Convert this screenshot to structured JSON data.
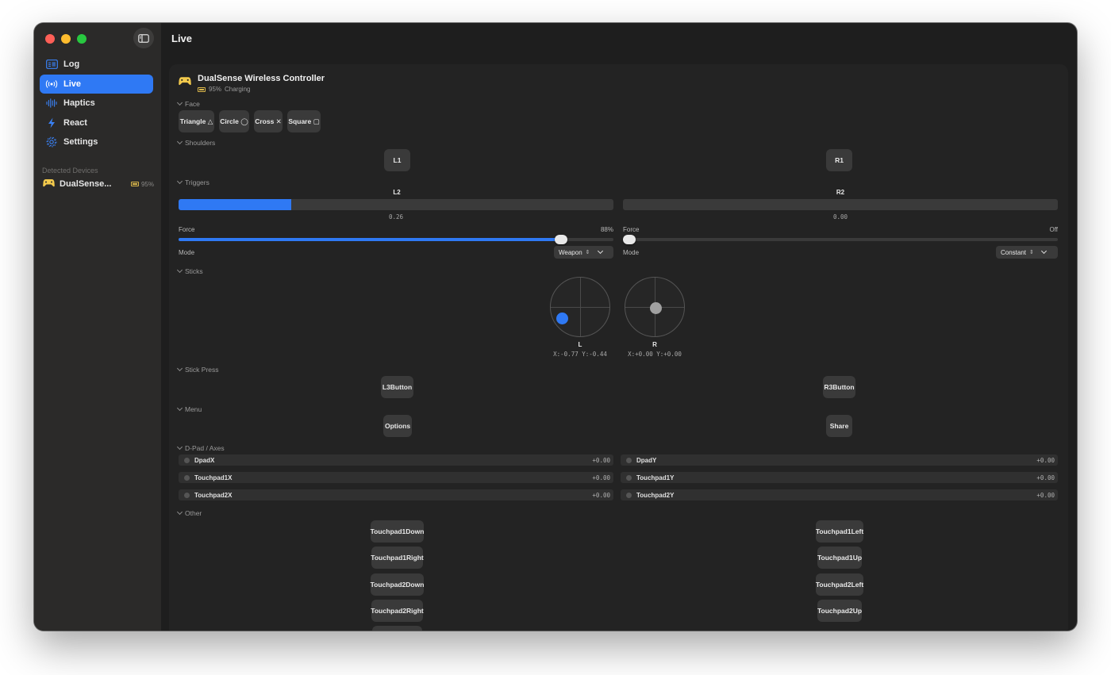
{
  "window": {
    "title": "Live"
  },
  "sidebar": {
    "items": [
      {
        "label": "Log",
        "icon": "log-icon"
      },
      {
        "label": "Live",
        "icon": "broadcast-icon",
        "active": true
      },
      {
        "label": "Haptics",
        "icon": "waveform-icon"
      },
      {
        "label": "React",
        "icon": "bolt-icon"
      },
      {
        "label": "Settings",
        "icon": "gear-icon"
      }
    ],
    "devices_label": "Detected Devices",
    "device": {
      "name": "DualSense...",
      "battery": "95%"
    }
  },
  "controller": {
    "name": "DualSense Wireless Controller",
    "battery": "95%",
    "status": "Charging"
  },
  "sections": {
    "face": "Face",
    "shoulders": "Shoulders",
    "triggers": "Triggers",
    "sticks": "Sticks",
    "stick_press": "Stick Press",
    "menu": "Menu",
    "dpad": "D-Pad / Axes",
    "other": "Other"
  },
  "face_buttons": [
    "Triangle △",
    "Circle ◯",
    "Cross ✕",
    "Square ▢"
  ],
  "shoulders": {
    "left": "L1",
    "right": "R1"
  },
  "triggers": {
    "left": {
      "label": "L2",
      "value": 0.26,
      "value_text": "0.26",
      "force_label": "Force",
      "force_text": "88%",
      "force": 0.88,
      "mode_label": "Mode",
      "mode": "Weapon"
    },
    "right": {
      "label": "R2",
      "value": 0.0,
      "value_text": "0.00",
      "force_label": "Force",
      "force_text": "Off",
      "force": 0.0,
      "mode_label": "Mode",
      "mode": "Constant"
    }
  },
  "sticks": {
    "left": {
      "label": "L",
      "x": -0.77,
      "y": -0.44,
      "readout": "X:-0.77 Y:-0.44",
      "color": "#2f79f4"
    },
    "right": {
      "label": "R",
      "x": 0.0,
      "y": 0.0,
      "readout": "X:+0.00 Y:+0.00",
      "color": "#a0a0a0"
    }
  },
  "stick_press": {
    "left": "L3Button",
    "right": "R3Button"
  },
  "menu": {
    "left": "Options",
    "right": "Share"
  },
  "axes": [
    {
      "name": "DpadX",
      "value": "+0.00"
    },
    {
      "name": "DpadY",
      "value": "+0.00"
    },
    {
      "name": "Touchpad1X",
      "value": "+0.00"
    },
    {
      "name": "Touchpad1Y",
      "value": "+0.00"
    },
    {
      "name": "Touchpad2X",
      "value": "+0.00"
    },
    {
      "name": "Touchpad2Y",
      "value": "+0.00"
    }
  ],
  "other_buttons": {
    "left": [
      "Touchpad1Down",
      "Touchpad1Right",
      "Touchpad2Down",
      "Touchpad2Right"
    ],
    "right": [
      "Touchpad1Left",
      "Touchpad1Up",
      "Touchpad2Left",
      "Touchpad2Up"
    ]
  },
  "colors": {
    "accent": "#2f79f4",
    "controller_icon": "#f2c94c"
  }
}
